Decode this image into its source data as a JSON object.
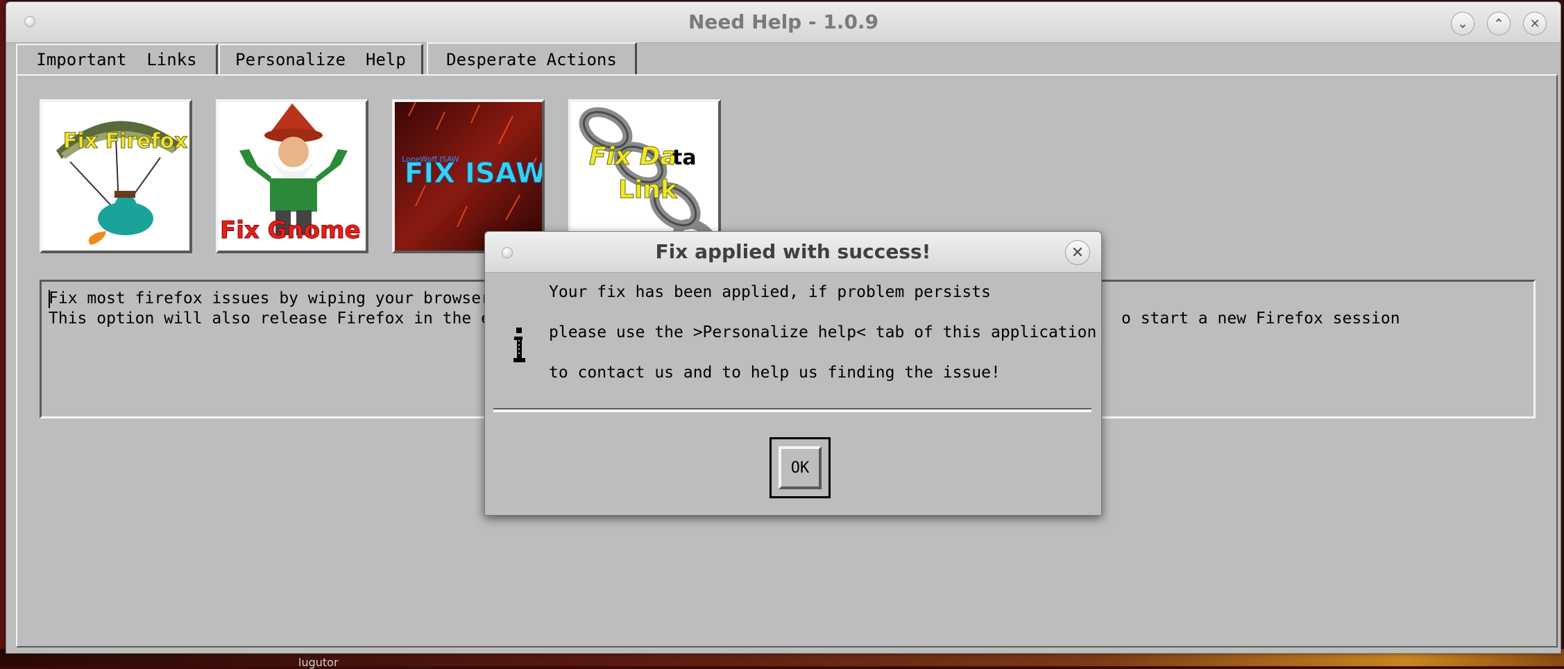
{
  "window": {
    "title": "Need Help - 1.0.9"
  },
  "tabs": [
    {
      "label": "Important  Links",
      "active": false
    },
    {
      "label": "Personalize  Help",
      "active": false
    },
    {
      "label": "Desperate Actions",
      "active": true
    }
  ],
  "actions": [
    {
      "caption": "Fix Firefox"
    },
    {
      "caption": "Fix Gnome"
    },
    {
      "caption": "FIX ISAW",
      "sub": "LoneWoff ISAW"
    },
    {
      "caption_top": "Fix Da",
      "caption_ta": "ta",
      "caption_bottom": "Link"
    }
  ],
  "description": {
    "line1_left": "Fix most firefox issues by wiping your browser p",
    "line2_left": "This option will also release Firefox in the eve",
    "line2_right": "o start a new Firefox session"
  },
  "dialog": {
    "title": "Fix applied with success!",
    "lines": [
      "Your fix has been applied, if problem persists",
      "please use the >Personalize help< tab of this application",
      "to contact us and to help us finding the issue!"
    ],
    "ok_label": "OK",
    "icon": "info-icon"
  },
  "taskbar": {
    "partial_text": "lugutor"
  },
  "colors": {
    "window_bg": "#bdbdbd",
    "title_text": "#7a7a7a",
    "dialog_title_text": "#404040"
  }
}
